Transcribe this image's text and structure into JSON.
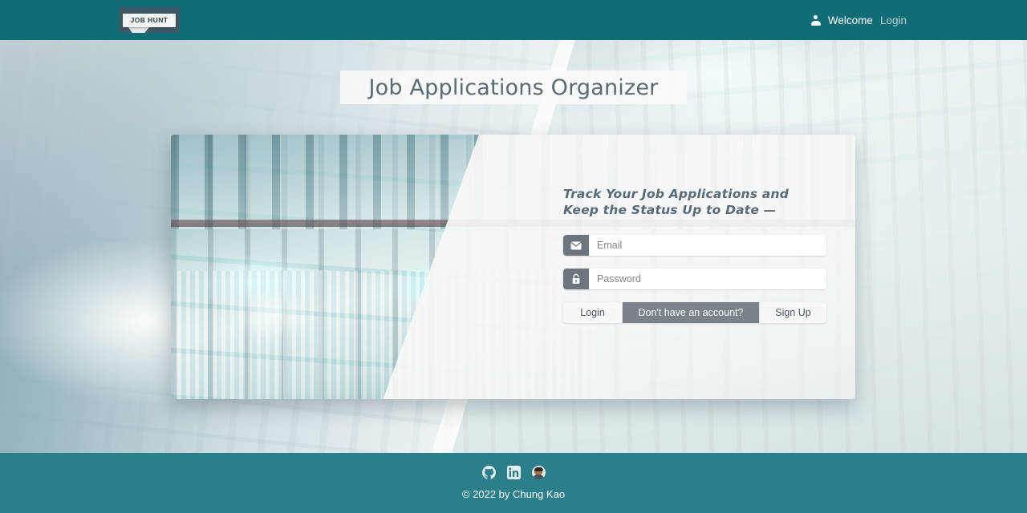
{
  "navbar": {
    "brand_text": "JOB HUNT",
    "welcome_label": "Welcome",
    "login_label": "Login",
    "user_icon": "user-icon",
    "background_color": "#0e6d77"
  },
  "hero": {
    "title": "Job Applications Organizer"
  },
  "login_card": {
    "tagline": "Track Your Job Applications and Keep the Status Up to Date —",
    "email": {
      "icon": "envelope-icon",
      "placeholder": "Email",
      "value": ""
    },
    "password": {
      "icon": "lock-icon",
      "placeholder": "Password",
      "value": ""
    },
    "login_button": "Login",
    "signup_prompt": "Don't have an account?",
    "signup_button": "Sign Up"
  },
  "footer": {
    "social": [
      {
        "name": "github-icon",
        "label": "GitHub"
      },
      {
        "name": "linkedin-icon",
        "label": "LinkedIn"
      },
      {
        "name": "avatar-icon",
        "label": "Chung Kao"
      }
    ],
    "copyright": "© 2022 by Chung Kao",
    "background_color": "#2b7f8a"
  },
  "colors": {
    "header_teal": "#0e6d77",
    "footer_teal": "#2b7f8a",
    "input_addon_gray": "#6c757d",
    "prompt_gray": "#7b8288",
    "title_gray": "#5d6a72"
  }
}
